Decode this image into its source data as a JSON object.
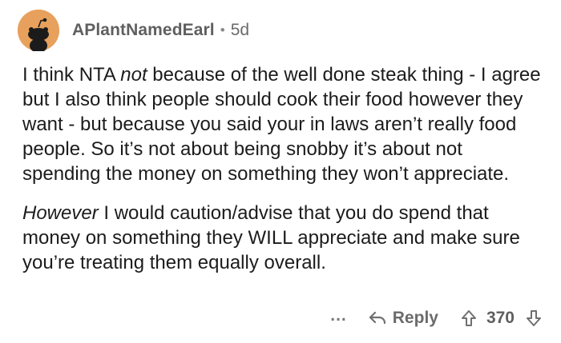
{
  "comment": {
    "author": "APlantNamedEarl",
    "separator": "•",
    "age": "5d",
    "paragraphs": [
      {
        "segments": [
          {
            "text": "I think NTA ",
            "italic": false
          },
          {
            "text": "not",
            "italic": true
          },
          {
            "text": " because of the well done steak thing - I agree but I also think people should cook their food however they want - but because you said your in laws aren’t really food people. So it’s not about being snobby it’s about not spending the money on something they won’t appreciate.",
            "italic": false
          }
        ]
      },
      {
        "segments": [
          {
            "text": "However",
            "italic": true
          },
          {
            "text": " I would caution/advise that you do spend that money on something they WILL appreciate and make sure you’re treating them equally overall.",
            "italic": false
          }
        ]
      }
    ]
  },
  "actions": {
    "more_label": "...",
    "reply_label": "Reply",
    "score": "370"
  },
  "icons": {
    "avatar": "snoo-avatar-icon",
    "reply": "reply-arrow-icon",
    "upvote": "upvote-arrow-icon",
    "downvote": "downvote-arrow-icon"
  },
  "colors": {
    "avatar_bg": "#e8a15c",
    "text": "#1c1c1c",
    "meta": "#6b6b6b"
  }
}
